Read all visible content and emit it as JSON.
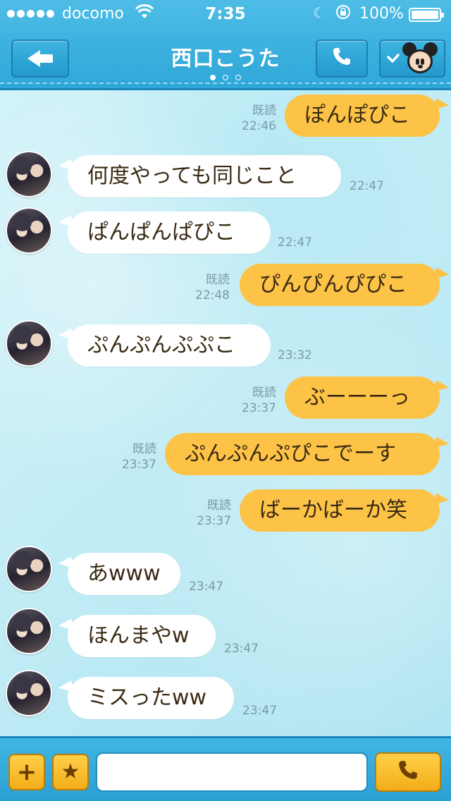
{
  "status_bar": {
    "carrier": "docomo",
    "time": "7:35",
    "battery": "100%"
  },
  "header": {
    "title": "西口こうた",
    "back_icon": "back-arrow-icon",
    "call_icon": "phone-icon",
    "menu_icon": "mickey-tsum-icon",
    "page_dots": 3,
    "active_dot": 1
  },
  "messages": [
    {
      "side": "out",
      "text": "ぽんぽぴこ",
      "read": "既読",
      "time": "22:46"
    },
    {
      "side": "in",
      "text": "何度やっても同じこと",
      "time": "22:47"
    },
    {
      "side": "in",
      "text": "ぱんぱんぱぴこ",
      "time": "22:47"
    },
    {
      "side": "out",
      "text": "ぴんぴんぴぴこ",
      "read": "既読",
      "time": "22:48"
    },
    {
      "side": "in",
      "text": "ぷんぷんぷぷこ",
      "time": "23:32"
    },
    {
      "side": "out",
      "text": "ぶーーーっ",
      "read": "既読",
      "time": "23:37"
    },
    {
      "side": "out",
      "text": "ぷんぷんぷぴこでーす",
      "read": "既読",
      "time": "23:37"
    },
    {
      "side": "out",
      "text": "ばーかばーか笑",
      "read": "既読",
      "time": "23:37"
    },
    {
      "side": "in",
      "text": "あwww",
      "time": "23:47"
    },
    {
      "side": "in",
      "text": "ほんまやw",
      "time": "23:47"
    },
    {
      "side": "in",
      "text": "ミスったww",
      "time": "23:47"
    }
  ],
  "input_bar": {
    "plus_label": "+",
    "star_label": "★",
    "message_value": "",
    "send_icon": "phone-icon"
  },
  "colors": {
    "header_blue": "#2ea7d8",
    "outgoing_bubble": "#fcc346",
    "incoming_bubble": "#ffffff",
    "button_yellow": "#f3ad18"
  }
}
